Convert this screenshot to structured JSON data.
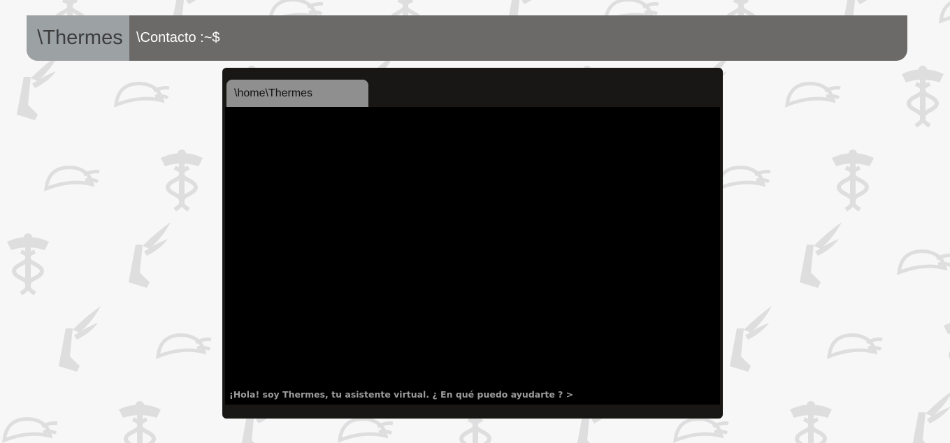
{
  "header": {
    "brand": "\\Thermes",
    "path": "\\Contacto :~$"
  },
  "terminal": {
    "tab_label": "\\home\\Thermes",
    "greeting": "¡Hola! soy Thermes, tu asistente virtual. ¿ En qué puedo ayudarte ? >",
    "input_value": ""
  },
  "colors": {
    "background": "#f7f7f7",
    "pattern": "#e0e0e0",
    "header_bar": "#6b6a69",
    "brand_block": "#9ca1a3",
    "terminal_frame": "#181716",
    "terminal_screen": "#000000",
    "tab": "#8f8f8f",
    "prompt_text": "#9b9b9b"
  },
  "background_icons": [
    "caduceus-icon",
    "winged-sandal-icon",
    "winged-helmet-icon"
  ]
}
